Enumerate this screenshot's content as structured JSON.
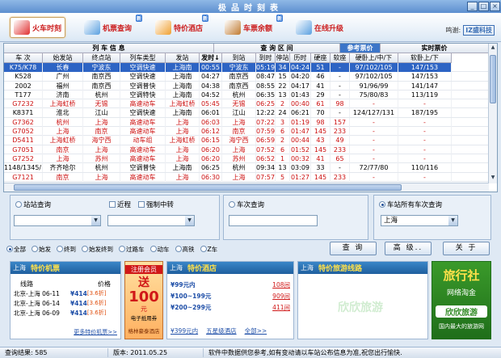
{
  "window": {
    "title": "极品时刻表",
    "min": "_",
    "max": "□",
    "close": "×"
  },
  "toolbar": {
    "items": [
      {
        "label": "火车时刻",
        "icon": "train-icon",
        "color": "#e03030",
        "new": ""
      },
      {
        "label": "机票查询",
        "icon": "plane-icon",
        "color": "#5aa0e0",
        "new": "新"
      },
      {
        "label": "特价酒店",
        "icon": "hotel-icon",
        "color": "#f0a030",
        "new": "新"
      },
      {
        "label": "车票余额",
        "icon": "ticket-icon",
        "color": "#c07a30",
        "new": "新"
      },
      {
        "label": "在线升级",
        "icon": "update-icon",
        "color": "#5aa0e0",
        "new": ""
      }
    ],
    "brand_text": "鸣谢:",
    "brand_logo": "IZ盛科技"
  },
  "grid": {
    "group_headers": [
      "列 车 信 息",
      "查 询 区 间",
      "参考票价",
      "实时票价"
    ],
    "columns": [
      "车 次",
      "始发站",
      "终点站",
      "列车类型",
      "发站",
      "发时",
      "到站",
      "到时",
      "停站",
      "历时",
      "硬座",
      "软座",
      "硬卧上/中/下",
      "软卧上/下"
    ],
    "sort_arrow": "↓",
    "rows": [
      [
        "K75/K78",
        "长春",
        "宁波东",
        "空调快速",
        "上海南",
        "00:55",
        "宁波东",
        "05:19",
        "34",
        "04:24",
        "51",
        "-",
        "97/102/105",
        "147/153"
      ],
      [
        "K528",
        "广州",
        "南京西",
        "空调快速",
        "上海南",
        "04:27",
        "南京西",
        "08:47",
        "15",
        "04:20",
        "46",
        "-",
        "97/102/105",
        "147/153"
      ],
      [
        "2002",
        "福州",
        "南京西",
        "空调普快",
        "上海南",
        "04:38",
        "南京西",
        "08:55",
        "22",
        "04:17",
        "41",
        "-",
        "91/96/99",
        "141/147"
      ],
      [
        "T177",
        "济南",
        "杭州",
        "空调特快",
        "上海南",
        "04:52",
        "杭州",
        "06:35",
        "13",
        "01:43",
        "29",
        "-",
        "75/80/83",
        "113/119"
      ],
      [
        "G7232",
        "上海虹桥",
        "无锡",
        "高速动车",
        "上海虹桥",
        "05:45",
        "无锡",
        "06:25",
        "2",
        "00:40",
        "61",
        "98",
        "-",
        "-"
      ],
      [
        "K8371",
        "淮北",
        "江山",
        "空调快速",
        "上海南",
        "06:01",
        "江山",
        "12:22",
        "24",
        "06:21",
        "70",
        "-",
        "124/127/131",
        "187/195"
      ],
      [
        "G7362",
        "杭州",
        "上海",
        "高速动车",
        "上海",
        "06:03",
        "上海",
        "07:22",
        "3",
        "01:19",
        "98",
        "157",
        "-",
        "-"
      ],
      [
        "G7052",
        "上海",
        "南京",
        "高速动车",
        "上海",
        "06:12",
        "南京",
        "07:59",
        "6",
        "01:47",
        "145",
        "233",
        "-",
        "-"
      ],
      [
        "D5411",
        "上海虹桥",
        "海宁西",
        "动车组",
        "上海虹桥",
        "06:15",
        "海宁西",
        "06:59",
        "2",
        "00:44",
        "43",
        "49",
        "-",
        "-"
      ],
      [
        "G7051",
        "南京",
        "上海",
        "高速动车",
        "上海",
        "06:20",
        "上海",
        "07:52",
        "6",
        "01:52",
        "145",
        "233",
        "-",
        "-"
      ],
      [
        "G7252",
        "上海",
        "苏州",
        "高速动车",
        "上海",
        "06:20",
        "苏州",
        "06:52",
        "1",
        "00:32",
        "41",
        "65",
        "-",
        "-"
      ],
      [
        "1148/1345/1344/1",
        "齐齐哈尔",
        "杭州",
        "空调普快",
        "上海南",
        "06:25",
        "杭州",
        "09:34",
        "13",
        "03:09",
        "33",
        "-",
        "72/77/80",
        "110/116"
      ],
      [
        "G7121",
        "南京",
        "上海",
        "高速动车",
        "上海",
        "06:30",
        "上海",
        "07:57",
        "5",
        "01:27",
        "145",
        "233",
        "-",
        "-"
      ]
    ],
    "red_rows": [
      4,
      6,
      7,
      8,
      9,
      10,
      12
    ]
  },
  "station_panel": {
    "title": "站站查询",
    "opt_transfer": "近程",
    "opt_force": "强制中转",
    "from_value": "",
    "to_value": ""
  },
  "train_panel": {
    "title": "车次查询",
    "value": ""
  },
  "all_panel": {
    "title": "车站所有车次查询",
    "value": "上海"
  },
  "filters": [
    "全部",
    "始发",
    "终到",
    "始发终到",
    "过路车",
    "动车",
    "高铁",
    "Z车"
  ],
  "buttons": {
    "query": "查 询",
    "advanced": "高 级..",
    "about": "关 于"
  },
  "ads": {
    "flights": {
      "city": "上海",
      "title": "特价机票",
      "col1": "线路",
      "col2": "价格",
      "rows": [
        {
          "route": "北京-上海 06-11",
          "price": "¥414",
          "disc": "[3.6折]"
        },
        {
          "route": "北京-上海 06-14",
          "price": "¥414",
          "disc": "[3.6折]"
        },
        {
          "route": "北京-上海 06-09",
          "price": "¥414",
          "disc": "[3.6折]"
        }
      ],
      "more": "更多特价机票>>"
    },
    "member": {
      "line1": "注册会员",
      "line2": "送",
      "line3": "100",
      "line4": "元",
      "line5": "电子抵用券",
      "line6": "格林豪泰酒店"
    },
    "hotels": {
      "city": "上海",
      "title": "特价酒店",
      "rows": [
        {
          "range": "¥99元内",
          "count": "108间"
        },
        {
          "range": "¥100~199元",
          "count": "909间"
        },
        {
          "range": "¥200~299元",
          "count": "411间"
        }
      ],
      "star1": "¥399元内",
      "star2": "五星级酒店",
      "more": "全部>>"
    },
    "tours": {
      "city": "上海",
      "title": "特价旅游线路"
    },
    "agency": {
      "line1": "旅行社",
      "line2": "网络淘金",
      "line3": "欣欣旅游",
      "line4": "国内最大的旅游网"
    }
  },
  "status": {
    "result": "查询结果: 585",
    "version": "版本: 2011.05.25",
    "notice": "软件中数据供您参考,如有变动请以车站公布信息为准,祝您出行愉快."
  },
  "watermark": "欣欣旅游"
}
